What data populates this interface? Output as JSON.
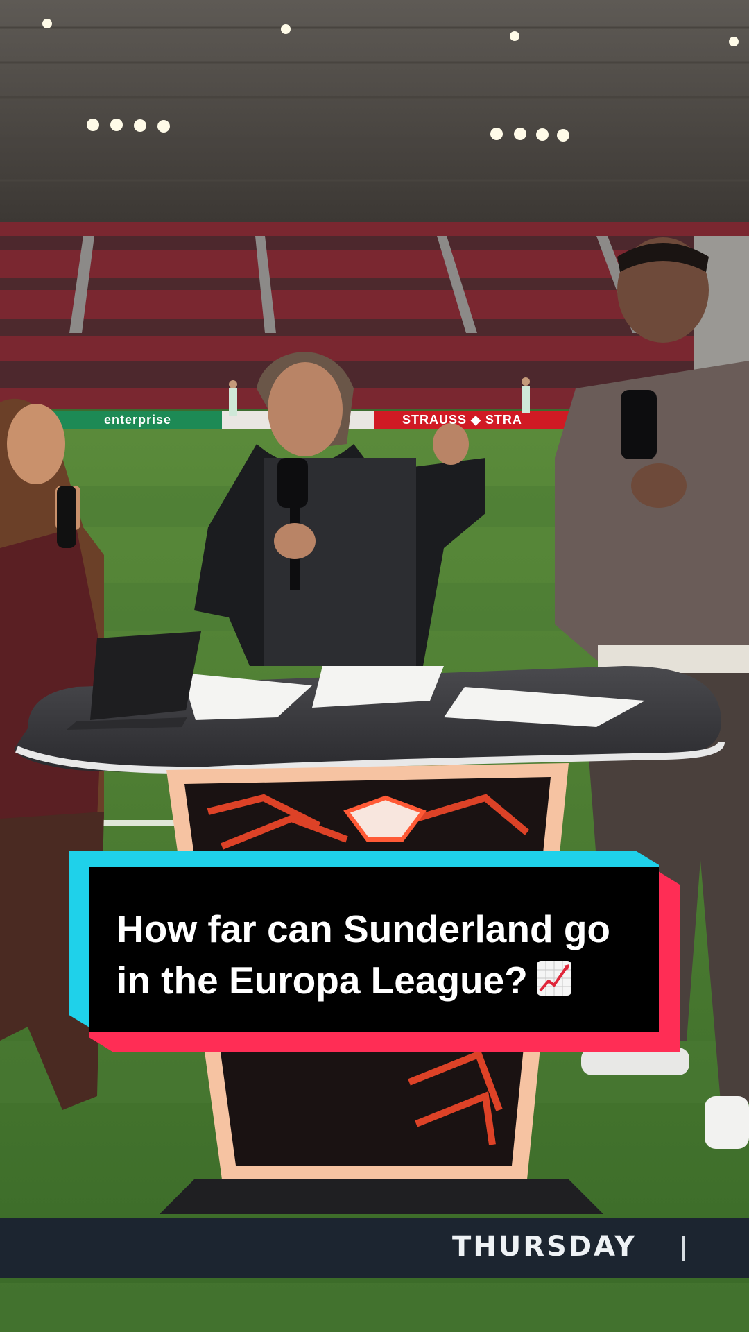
{
  "caption": {
    "line1": "How far can Sunderland go",
    "line2": "in the Europa League?",
    "emoji_icon": "chart-increasing-icon"
  },
  "ticker": {
    "day": "THURSDAY"
  },
  "ad_boards": {
    "left": "enterprise",
    "right": "STRAUSS ◆ STRA"
  },
  "colors": {
    "caption_cyan": "#1fd1ea",
    "caption_red": "#ff2d55",
    "caption_bg": "#000000",
    "ticker_bg": "#1c2530"
  }
}
